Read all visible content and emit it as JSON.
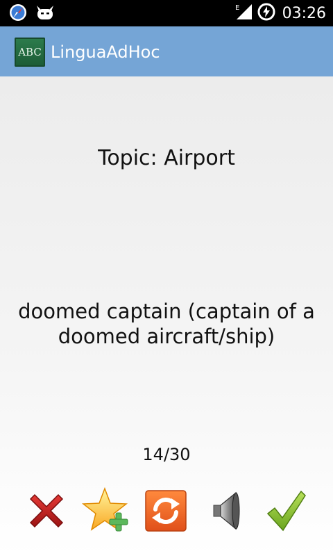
{
  "status_bar": {
    "time": "03:26",
    "network_label": "E",
    "icons": [
      "browser-compass-icon",
      "cat-notification-icon",
      "signal-icon",
      "battery-charging-icon"
    ]
  },
  "app": {
    "title": "LinguaAdHoc",
    "icon_text": "ABC",
    "accent_color": "#75a5d6"
  },
  "card": {
    "topic": "Topic: Airport",
    "word": "doomed captain (captain of a doomed aircraft/ship)",
    "counter": "14/30"
  },
  "toolbar": {
    "buttons": [
      {
        "name": "wrong-button",
        "icon": "red-x-icon"
      },
      {
        "name": "add-favorite-button",
        "icon": "star-plus-icon"
      },
      {
        "name": "refresh-button",
        "icon": "refresh-icon"
      },
      {
        "name": "speak-button",
        "icon": "speaker-icon"
      },
      {
        "name": "correct-button",
        "icon": "green-check-icon"
      }
    ]
  }
}
